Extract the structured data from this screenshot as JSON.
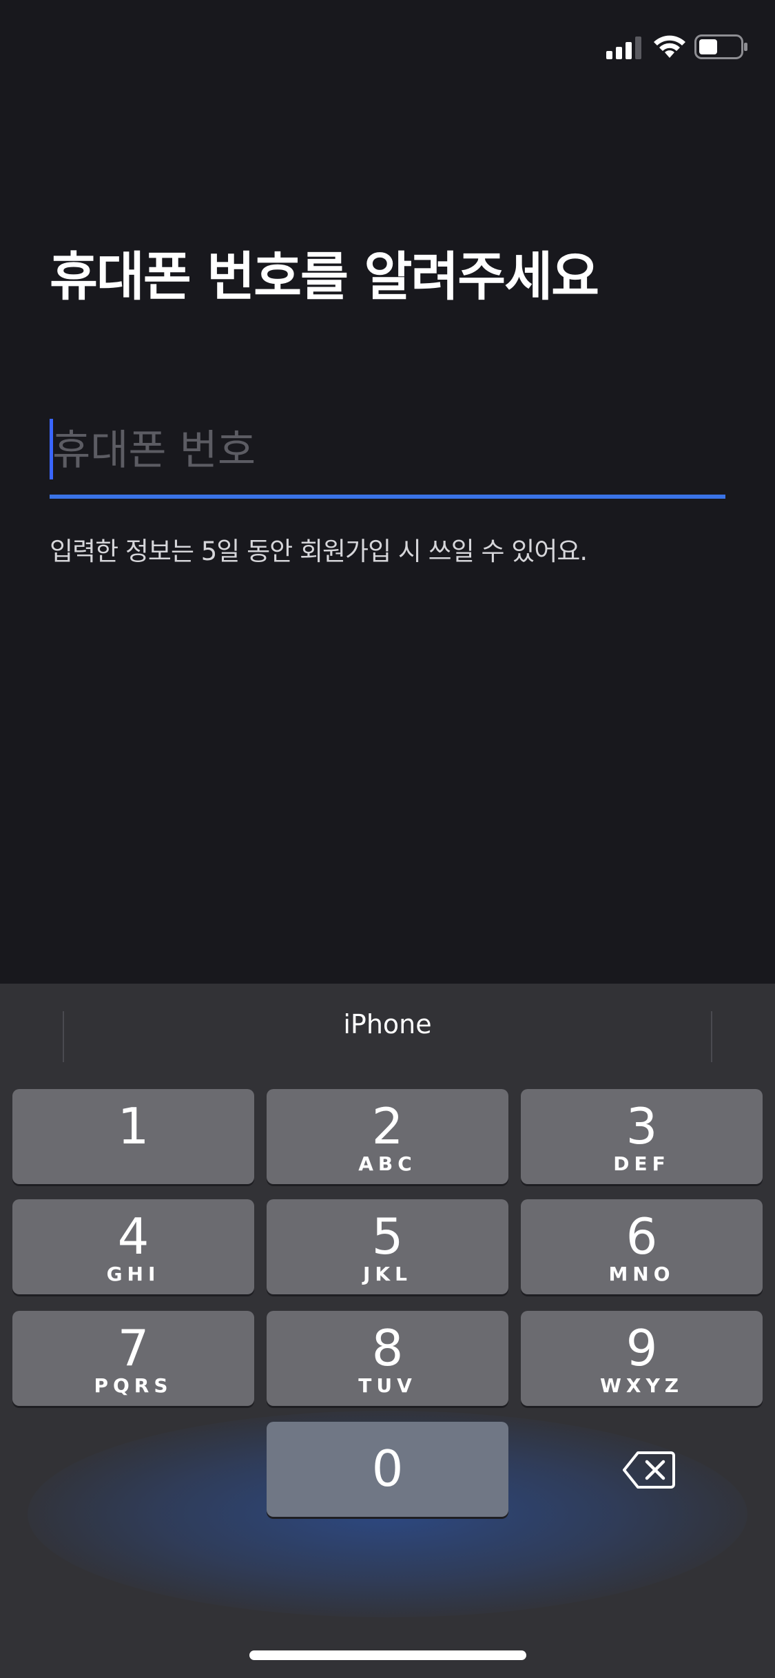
{
  "status_bar": {
    "signal_icon": "cellular-signal-icon",
    "wifi_icon": "wifi-icon",
    "battery_icon": "battery-icon",
    "battery_level": 0.45
  },
  "header": {
    "title": "휴대폰 번호를 알려주세요"
  },
  "phone_field": {
    "value": "",
    "placeholder": "휴대폰 번호"
  },
  "helper_text": "입력한 정보는 5일 동안 회원가입 시 쓰일 수 있어요.",
  "keyboard": {
    "suggestion": "iPhone",
    "keys": [
      {
        "digit": "1",
        "letters": ""
      },
      {
        "digit": "2",
        "letters": "ABC"
      },
      {
        "digit": "3",
        "letters": "DEF"
      },
      {
        "digit": "4",
        "letters": "GHI"
      },
      {
        "digit": "5",
        "letters": "JKL"
      },
      {
        "digit": "6",
        "letters": "MNO"
      },
      {
        "digit": "7",
        "letters": "PQRS"
      },
      {
        "digit": "8",
        "letters": "TUV"
      },
      {
        "digit": "9",
        "letters": "WXYZ"
      },
      {
        "digit": "0",
        "letters": ""
      }
    ],
    "delete_icon": "backspace-icon"
  },
  "colors": {
    "background": "#18181d",
    "accent": "#3a73e6",
    "keyboard_bg": "#323236",
    "key_bg": "#6b6b70"
  }
}
